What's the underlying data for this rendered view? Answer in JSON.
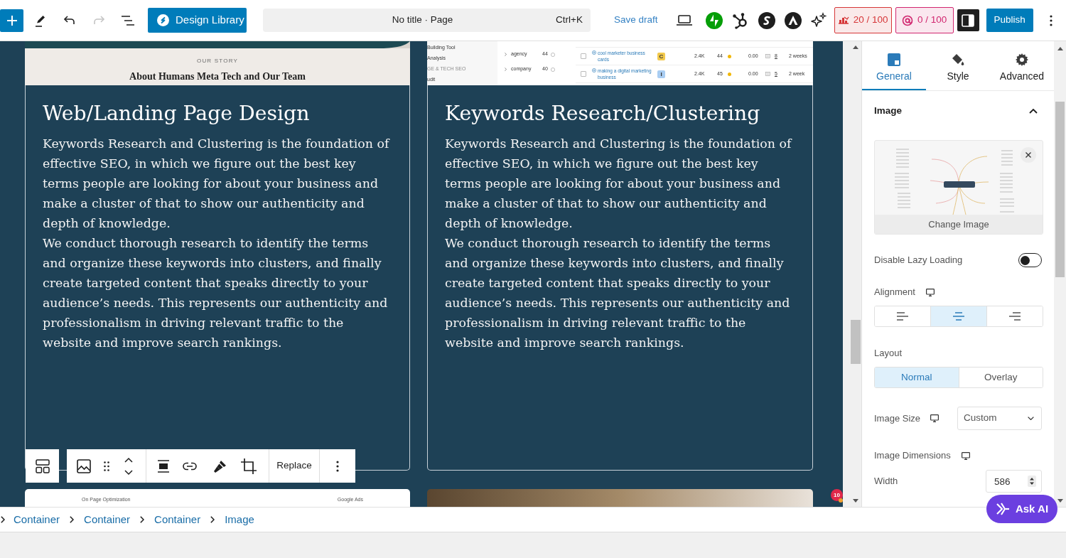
{
  "topbar": {
    "history": [
      {
        "kind": "undo",
        "disabled": false
      },
      {
        "kind": "redo",
        "disabled": true
      }
    ],
    "library_button": "Design Library",
    "command": {
      "title": "No title · Page",
      "shortcut": "Ctrl+K"
    },
    "save_draft": "Save draft",
    "scores": [
      {
        "text": "20 / 100",
        "color": "#d63638"
      },
      {
        "text": "0 / 100",
        "color": "#d1266f"
      }
    ],
    "sidebar_toggle": {
      "pressed": true
    },
    "publish": "Publish"
  },
  "canvas": {
    "cards": [
      {
        "image": {
          "kind": "site",
          "eyebrow": "OUR STORY",
          "heading": "About Humans Meta Tech and Our Team"
        },
        "title": "Web/Landing Page Design",
        "paragraphs": [
          "Keywords Research and Clustering is the foundation of effective SEO, in which we figure out the best key terms people are looking for about your business and make a cluster of that to show our authenticity and depth of knowledge.",
          "We conduct thorough research to identify the terms and organize these keywords into clusters, and finally create targeted content that speaks directly to your audience’s needs. This represents our authenticity and professionalism in driving relevant traffic to the website and improve search rankings."
        ]
      },
      {
        "image": {
          "kind": "table",
          "sidebar": [
            {
              "text": "Building Tool",
              "kind": "item"
            },
            {
              "text": "Analysis",
              "kind": "item"
            },
            {
              "text": "GE & TECH SEO",
              "kind": "heading"
            },
            {
              "text": "udit",
              "kind": "item"
            }
          ],
          "groups": [
            {
              "name": "agency",
              "count": "44"
            },
            {
              "name": "company",
              "count": "40"
            }
          ],
          "rows": [
            {
              "checked": false,
              "keyword": "cool marketer business cards",
              "intent": "C",
              "color": "#f2c94c",
              "volume": "2.4K",
              "kd": "44",
              "cpc": "0.00",
              "results": "8",
              "updated": "2 weeks"
            },
            {
              "checked": false,
              "keyword": "making a digital marketing business",
              "intent": "I",
              "color": "#a9cdf2",
              "volume": "2.4K",
              "kd": "45",
              "cpc": "0.00",
              "results": "5",
              "updated": "2 week"
            }
          ]
        },
        "title": "Keywords Research/Clustering",
        "paragraphs": [
          "Keywords Research and Clustering is the foundation of effective SEO, in which we figure out the best key terms people are looking for about your business and make a cluster of that to show our authenticity and depth of knowledge.",
          "We conduct thorough research to identify the terms and organize these keywords into clusters, and finally create targeted content that speaks directly to your audience’s needs. This represents our authenticity and professionalism in driving relevant traffic to the website and improve search rankings."
        ]
      }
    ],
    "next_cards": [
      {
        "kind": "mindmap",
        "labels": [
          "On Page Optimization",
          "Google Ads"
        ]
      },
      {
        "kind": "photo"
      }
    ],
    "block_toolbar": {
      "replace": "Replace"
    },
    "notification_count": "10"
  },
  "panel": {
    "tabs": [
      {
        "label": "General",
        "selected": true
      },
      {
        "label": "Style",
        "selected": false
      },
      {
        "label": "Advanced",
        "selected": false
      }
    ],
    "section": {
      "title": "Image",
      "expanded": true
    },
    "image_control": {
      "action": "Change Image"
    },
    "lazy_loading": {
      "label": "Disable Lazy Loading",
      "on": false
    },
    "alignment": {
      "label": "Alignment",
      "options": [
        {
          "selected": false
        },
        {
          "selected": true
        },
        {
          "selected": false
        }
      ]
    },
    "layout": {
      "label": "Layout",
      "options": [
        {
          "label": "Normal",
          "selected": true
        },
        {
          "label": "Overlay",
          "selected": false
        }
      ]
    },
    "image_size": {
      "label": "Image Size",
      "value": "Custom"
    },
    "dimensions": {
      "label": "Image Dimensions"
    },
    "width": {
      "label": "Width",
      "value": "586"
    }
  },
  "breadcrumb": [
    "Container",
    "Container",
    "Container",
    "Image"
  ],
  "ask_ai": "Ask AI"
}
